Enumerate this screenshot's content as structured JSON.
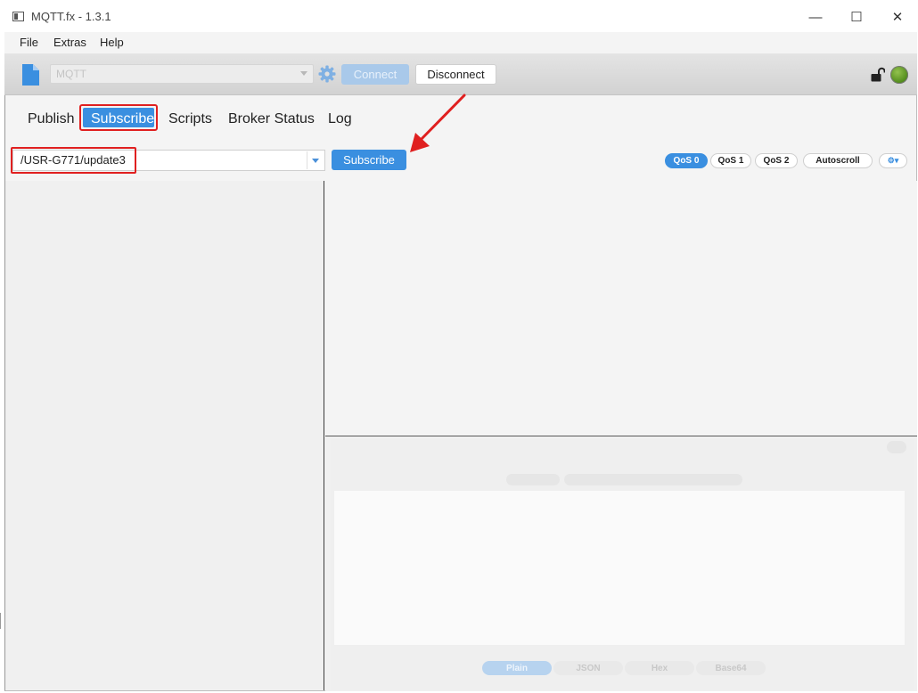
{
  "window": {
    "title": "MQTT.fx - 1.3.1",
    "minimize_glyph": "—",
    "maximize_glyph": "☐",
    "close_glyph": "✕"
  },
  "menu": {
    "items": [
      "File",
      "Extras",
      "Help"
    ]
  },
  "toolbar": {
    "profile_value": "MQTT",
    "connect_label": "Connect",
    "disconnect_label": "Disconnect",
    "icons": [
      "document-icon",
      "gear-icon",
      "unlocked-lock-icon",
      "connection-status-icon"
    ],
    "status_color": "#5a9a1e"
  },
  "tabs": {
    "items": [
      "Publish",
      "Subscribe",
      "Scripts",
      "Broker Status",
      "Log"
    ],
    "active": "Subscribe"
  },
  "subscribe": {
    "topic_value": "/USR-G771/update3",
    "button_label": "Subscribe",
    "qos_options": [
      "QoS 0",
      "QoS 1",
      "QoS 2"
    ],
    "qos_selected": "QoS 0",
    "autoscroll_label": "Autoscroll",
    "settings_glyph": "⚙▾"
  },
  "payload_formats": {
    "items": [
      "Plain",
      "JSON",
      "Hex",
      "Base64"
    ],
    "selected": "Plain"
  },
  "colors": {
    "accent": "#3a8fe0",
    "annotation": "#e02020"
  }
}
